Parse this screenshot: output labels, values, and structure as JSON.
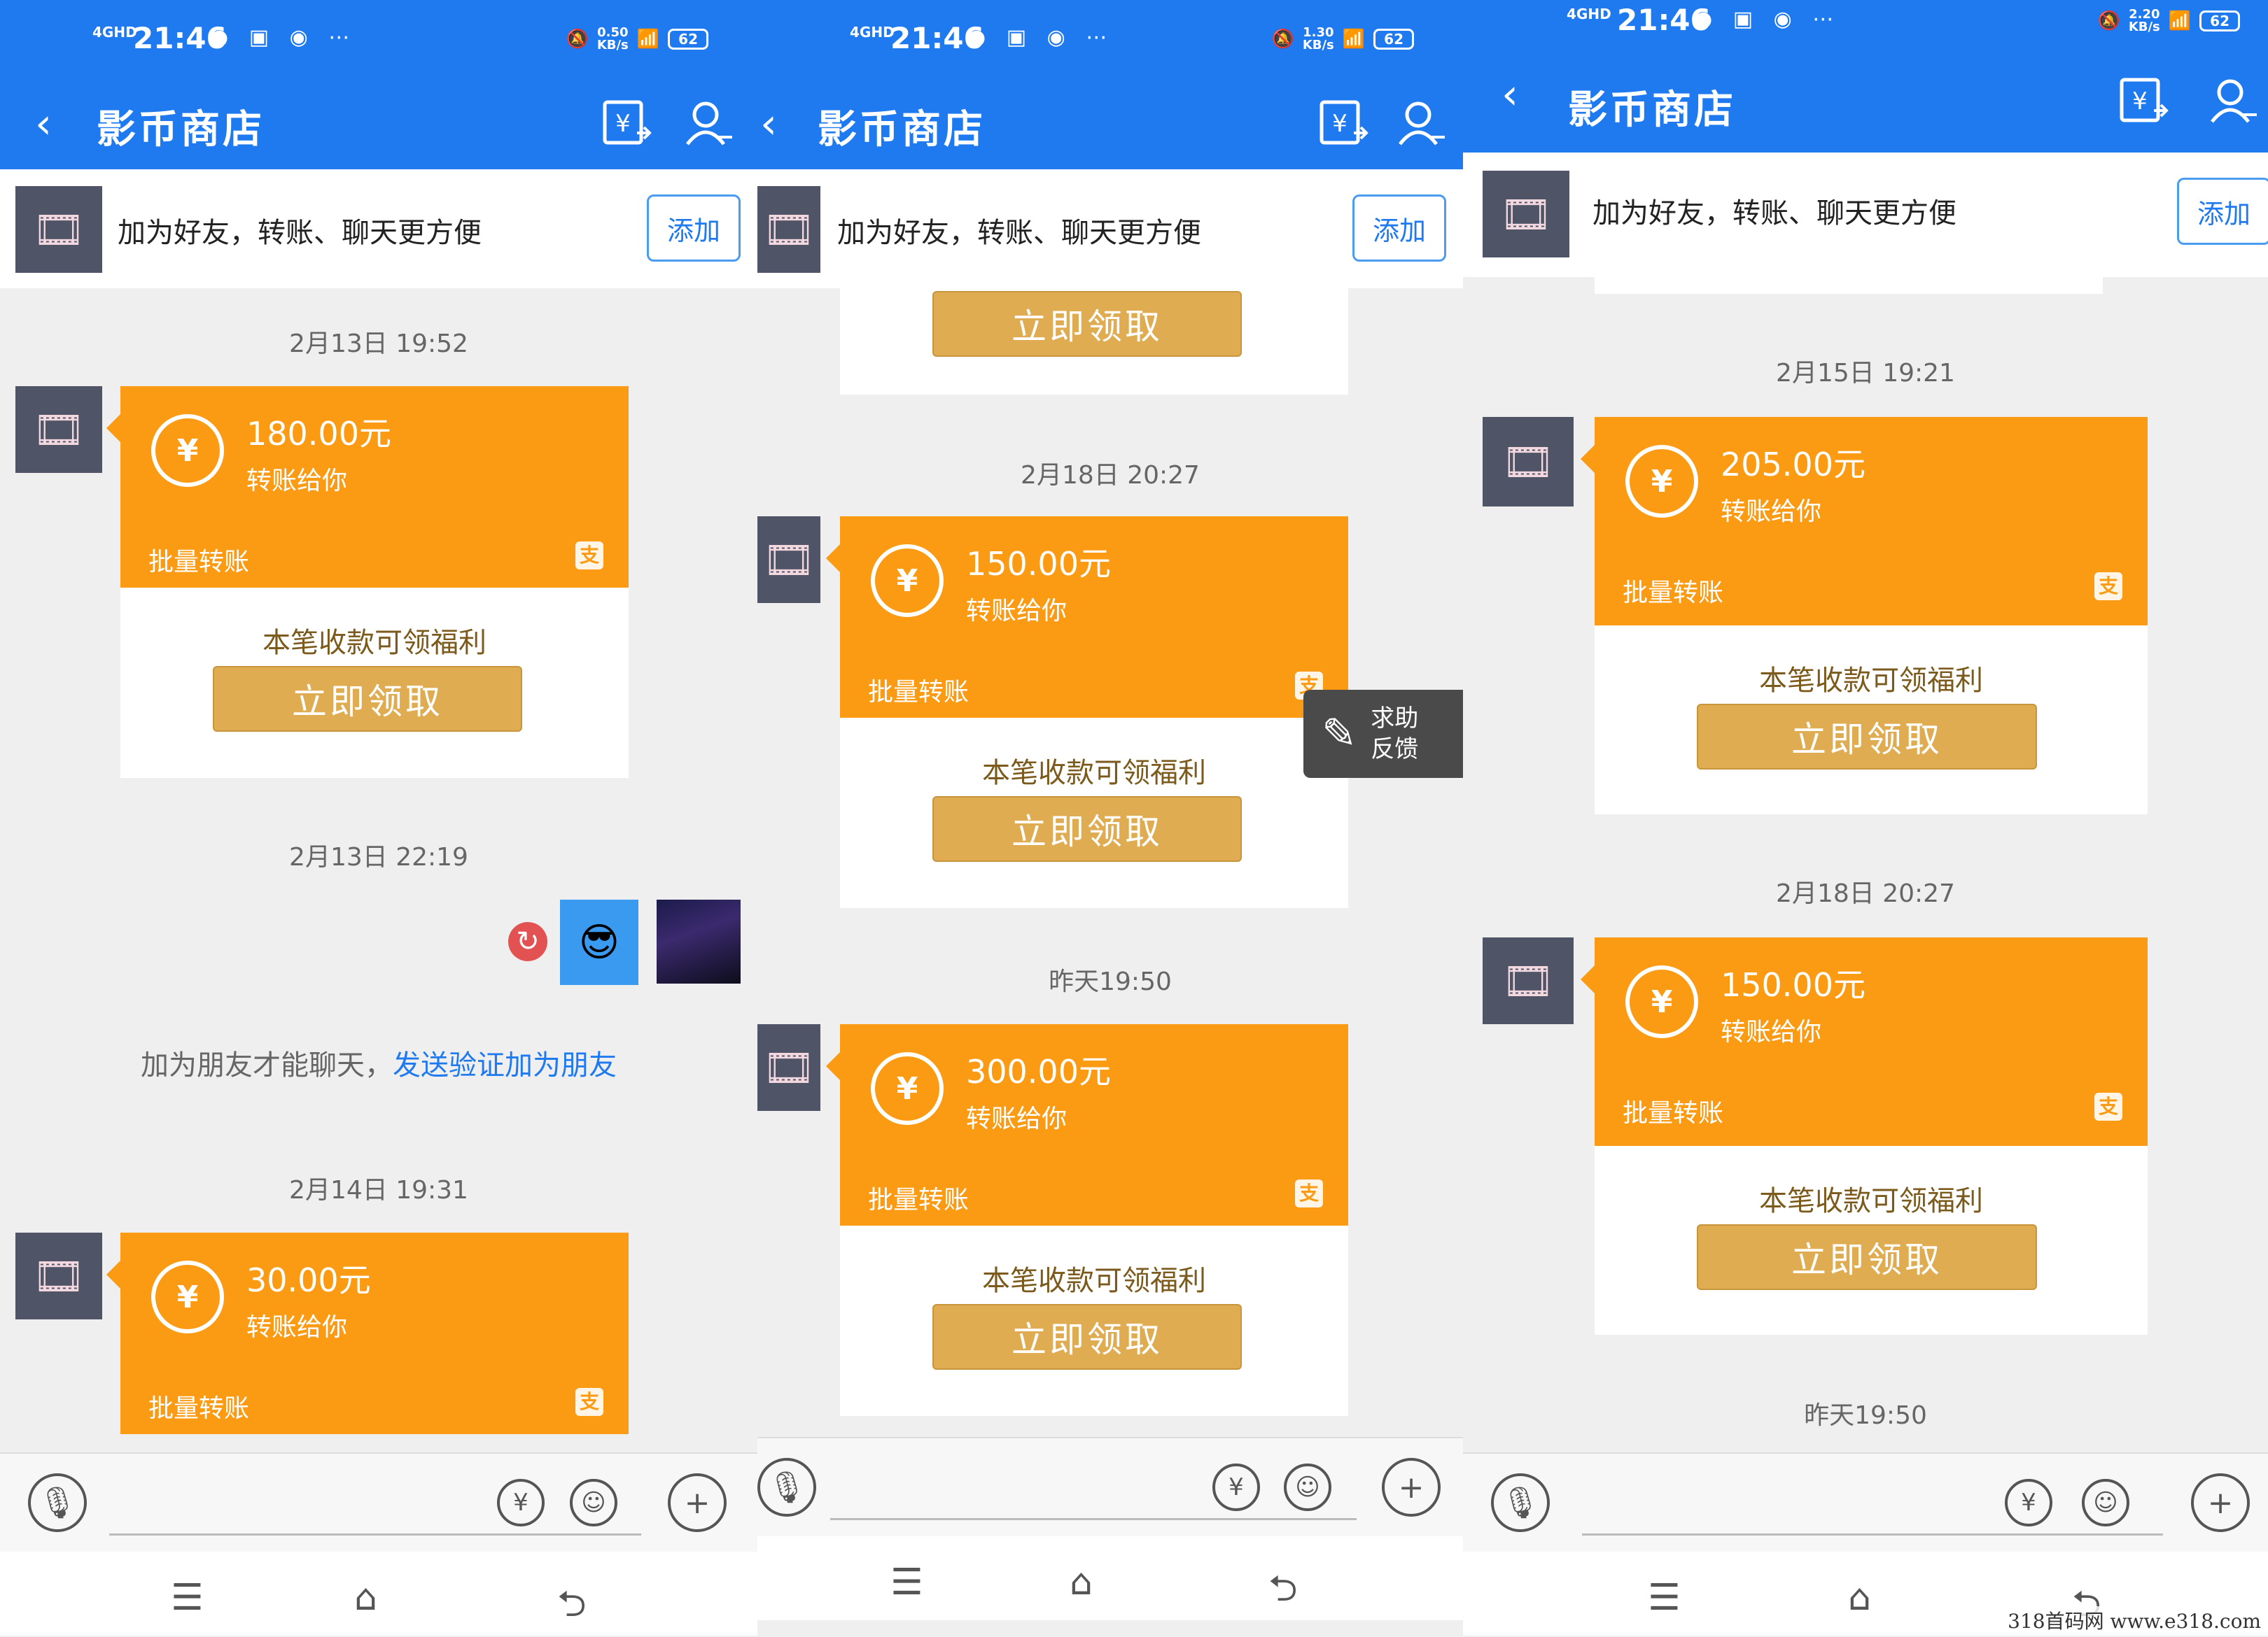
{
  "status": {
    "time": "21:46",
    "network": "4GHD",
    "speed_values": [
      "0.50",
      "1.30",
      "2.20"
    ],
    "speed_unit": "KB/s",
    "battery": "62"
  },
  "header": {
    "title": "影币商店"
  },
  "add_friend": {
    "text": "加为好友，转账、聊天更方便",
    "button": "添加"
  },
  "card_labels": {
    "sub": "转账给你",
    "batch": "批量转账",
    "benefit": "本笔收款可领福利",
    "claim": "立即领取",
    "currency_glyph": "¥",
    "brand_glyph": "支"
  },
  "panel1": {
    "ts1": "2月13日 19:52",
    "amount1": "180.00元",
    "ts2": "2月13日 22:19",
    "hint_prefix": "加为朋友才能聊天，",
    "hint_link": "发送验证加为朋友",
    "ts3": "2月14日 19:31",
    "amount2": "30.00元"
  },
  "panel2": {
    "ts1": "2月18日 20:27",
    "amount1": "150.00元",
    "ts2": "昨天19:50",
    "amount2": "300.00元"
  },
  "panel3": {
    "ts1": "2月15日 19:21",
    "amount1": "205.00元",
    "ts2": "2月18日 20:27",
    "amount2": "150.00元",
    "ts3": "昨天19:50"
  },
  "feedback": {
    "line1": "求助",
    "line2": "反馈"
  },
  "watermark": "318首码网 www.e318.com",
  "colors": {
    "primary": "#1f7af0",
    "card_orange": "#fb9b13",
    "claim_gold": "#e0ac52"
  }
}
